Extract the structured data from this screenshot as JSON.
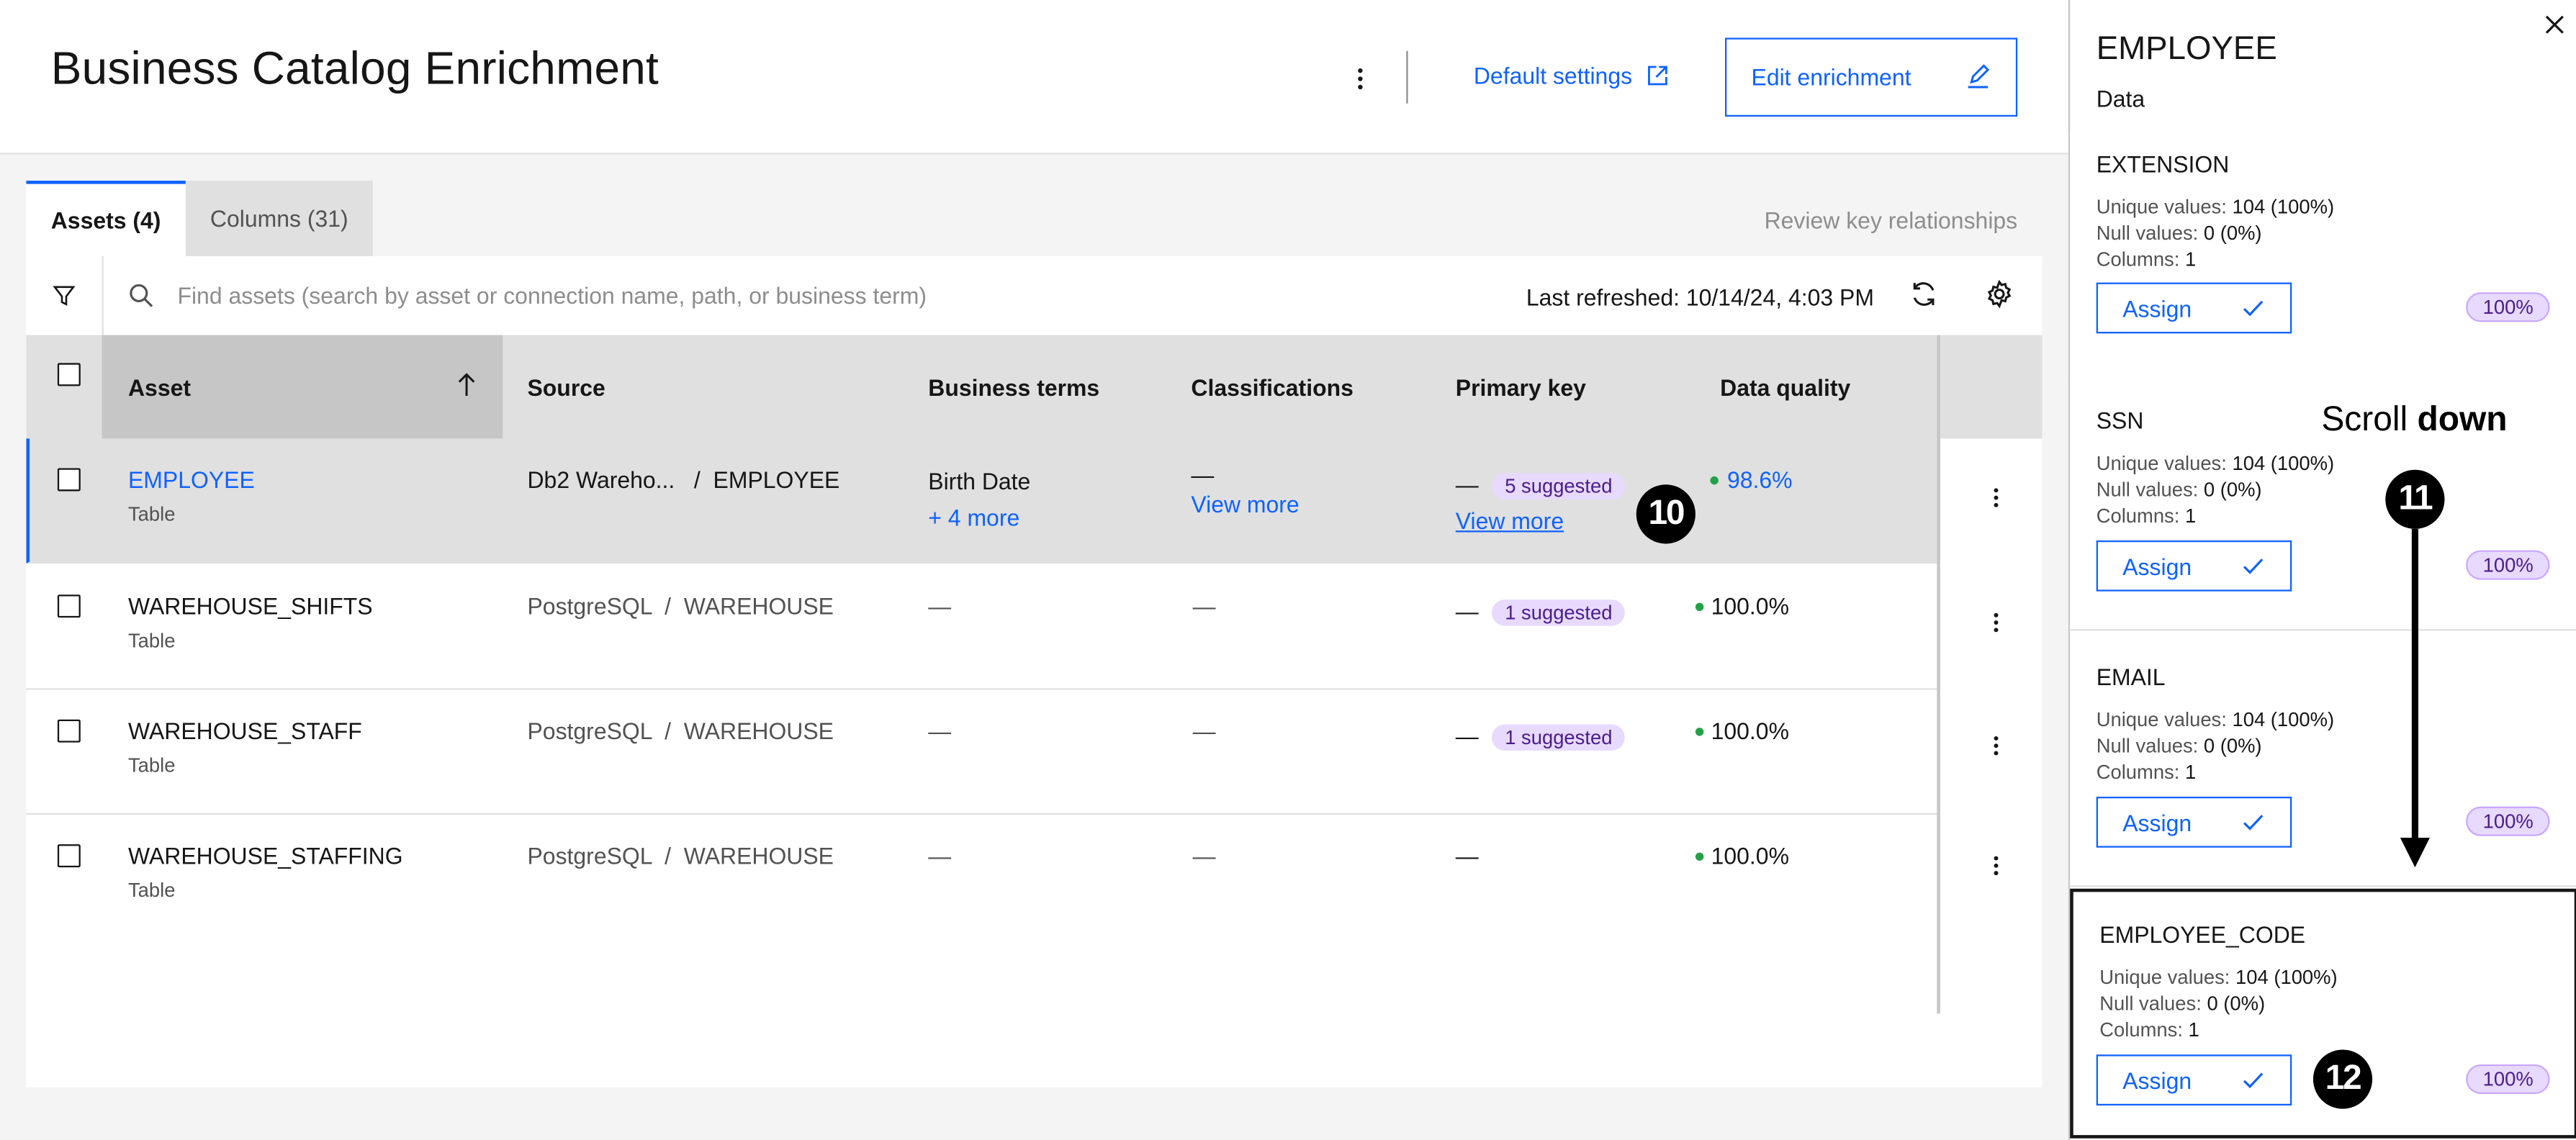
{
  "header": {
    "title": "Business Catalog Enrichment",
    "default_settings_label": "Default settings",
    "edit_label": "Edit enrichment"
  },
  "tabs": [
    {
      "label": "Assets (4)",
      "active": true
    },
    {
      "label": "Columns (31)",
      "active": false
    }
  ],
  "review_link": "Review key relationships",
  "toolbar": {
    "search_placeholder": "Find assets (search by asset or connection name, path, or business term)",
    "last_refreshed": "Last refreshed: 10/14/24, 4:03 PM"
  },
  "table": {
    "headers": {
      "asset": "Asset",
      "source": "Source",
      "business_terms": "Business terms",
      "classifications": "Classifications",
      "primary_key": "Primary key",
      "data_quality": "Data quality"
    },
    "rows": [
      {
        "asset": "EMPLOYEE",
        "type": "Table",
        "source": "Db2 Wareho...",
        "source_sep": "/",
        "source_path": "EMPLOYEE",
        "business_term": "Birth Date",
        "business_more": "+ 4 more",
        "classification": "—",
        "classification_more": "View more",
        "pk_dash": "—",
        "pk_tag": "5 suggested",
        "pk_more": "View more",
        "dq": "98.6%"
      },
      {
        "asset": "WAREHOUSE_SHIFTS",
        "type": "Table",
        "source": "PostgreSQL",
        "source_sep": "/",
        "source_path": "WAREHOUSE",
        "business_term": "—",
        "classification": "—",
        "pk_dash": "—",
        "pk_tag": "1 suggested",
        "dq": "100.0%"
      },
      {
        "asset": "WAREHOUSE_STAFF",
        "type": "Table",
        "source": "PostgreSQL",
        "source_sep": "/",
        "source_path": "WAREHOUSE",
        "business_term": "—",
        "classification": "—",
        "pk_dash": "—",
        "pk_tag": "1 suggested",
        "dq": "100.0%"
      },
      {
        "asset": "WAREHOUSE_STAFFING",
        "type": "Table",
        "source": "PostgreSQL",
        "source_sep": "/",
        "source_path": "WAREHOUSE",
        "business_term": "—",
        "classification": "—",
        "pk_dash": "—",
        "dq": "100.0%"
      }
    ]
  },
  "panel": {
    "title": "EMPLOYEE",
    "subtitle": "Data",
    "stat_labels": {
      "unique": "Unique values:",
      "null": "Null values:",
      "columns": "Columns:"
    },
    "assign_label": "Assign",
    "cards": [
      {
        "name": "EXTENSION",
        "unique": "104 (100%)",
        "null": "0 (0%)",
        "columns": "1",
        "pct": "100%"
      },
      {
        "name": "SSN",
        "unique": "104 (100%)",
        "null": "0 (0%)",
        "columns": "1",
        "pct": "100%"
      },
      {
        "name": "EMAIL",
        "unique": "104 (100%)",
        "null": "0 (0%)",
        "columns": "1",
        "pct": "100%"
      },
      {
        "name": "EMPLOYEE_CODE",
        "unique": "104 (100%)",
        "null": "0 (0%)",
        "columns": "1",
        "pct": "100%"
      }
    ]
  },
  "annotations": {
    "badge_10": "10",
    "badge_11": "11",
    "badge_12": "12",
    "scroll_text": "Scroll",
    "scroll_bold": "down"
  },
  "icons": {
    "overflow": "overflow-menu-vertical-icon",
    "launch": "launch-icon",
    "edit": "edit-pencil-icon",
    "filter": "filter-icon",
    "search": "search-icon",
    "refresh": "refresh-icon",
    "settings": "gear-icon",
    "sort": "arrow-up-icon",
    "check": "checkmark-icon",
    "close": "close-icon"
  },
  "colors": {
    "accent": "#0f62fe",
    "success": "#24a148",
    "tag_bg": "#e8daff",
    "tag_text": "#491d8b"
  }
}
